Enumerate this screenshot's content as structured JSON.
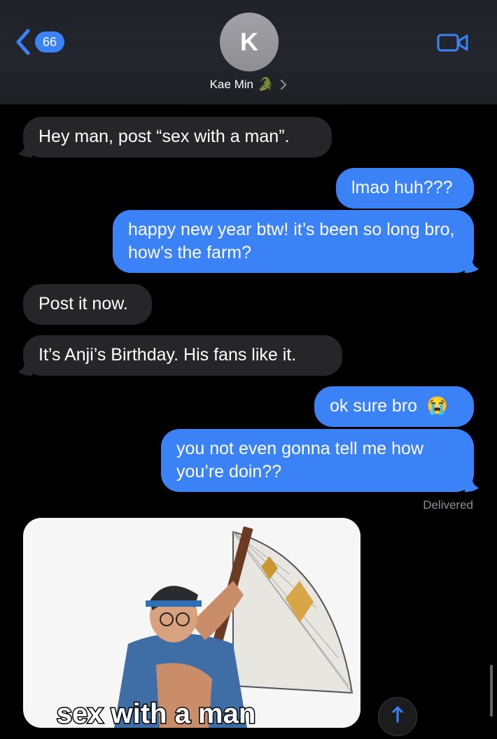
{
  "header": {
    "back_badge": "66",
    "avatar_initial": "K",
    "contact_name": "Kae Min",
    "contact_emoji": "🐊"
  },
  "messages": [
    {
      "side": "received",
      "text": "Hey man, post “sex with a man”."
    },
    {
      "side": "sent",
      "text": "lmao huh???"
    },
    {
      "side": "sent",
      "text": "happy new year btw! it’s been so long bro, how’s the farm?"
    },
    {
      "side": "received",
      "text": "Post it now."
    },
    {
      "side": "received",
      "text": "It’s Anji’s Birthday. His fans like it."
    },
    {
      "side": "sent",
      "text": "ok sure bro",
      "emoji": "😭"
    },
    {
      "side": "sent",
      "text": "you not even gonna tell me how you’re doin??"
    }
  ],
  "status": {
    "delivered": "Delivered"
  },
  "image_message": {
    "caption": "sex with a man"
  },
  "colors": {
    "sent_bubble": "#3b82f6",
    "received_bubble": "#262628",
    "background": "#000000"
  }
}
